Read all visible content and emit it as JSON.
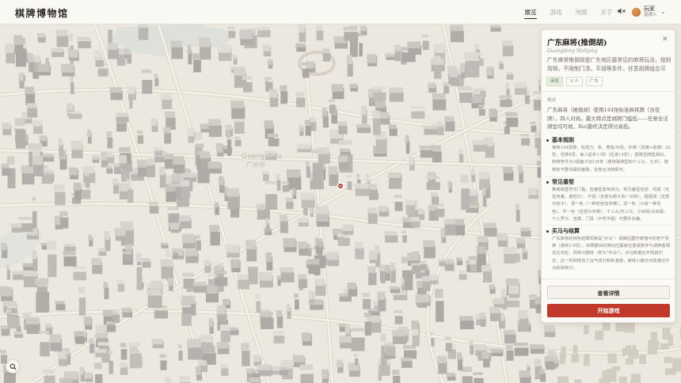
{
  "header": {
    "logo": "棋牌博物馆",
    "nav": [
      {
        "label": "展览",
        "active": true
      },
      {
        "label": "游戏",
        "active": false
      },
      {
        "label": "地图",
        "active": false
      },
      {
        "label": "关于",
        "active": false
      }
    ],
    "mute_icon": "speaker-muted-icon",
    "user": {
      "name": "玩家",
      "role": "普通人"
    }
  },
  "map": {
    "district_label_cn": "广州市",
    "district_label_en": "Guangzhou",
    "marker_color": "#c0392b"
  },
  "panel": {
    "title": "广东麻将(推倒胡)",
    "subtitle": "Guangdong Mahjong",
    "intro": "广东麻将推倒胡是广东地区最常见的麻将玩法，规则简明，不限制门清，平胡等条件，任意胡牌组合可胡。",
    "tags": [
      "麻将",
      "4 人",
      "广东"
    ],
    "overview_label": "概述",
    "overview": "广东麻将（推倒胡）使用144张标准麻将牌（含花牌），四人对局。最大特点是胡牌门槛低——任意合法牌型均可胡，But最终决定得分高低。",
    "sections": [
      {
        "title": "基本规则",
        "body": "使用144张牌，包括万、条、筒各36张，字牌（风牌+箭牌）28张，花牌8张。每人起手13张（庄家14张），摸牌至牌型胡出。和牌条件为3组面子加1对将（或特殊牌型如十三幺、七对），摸牌前不要求最低番数，任意合法牌即可。"
      },
      {
        "title": "常见番型",
        "body": "推倒胡虽然无门槛，但番型影响得分。常见番型包括：鸡胡（无任何番，最低分）、平胡（全部为顺子加一对将）、碰碰胡（全部为刻子）、混一色（一种花色加字牌）、清一色（只有一种花色）、字一色（全部为字牌）、十三幺/天三元、小四喜/大四喜、十八罗汉、自摸、门清（不吃不碰）可额外加番。"
      },
      {
        "title": "买马与结算",
        "body": "广东麻将的特色结算机制是\"买马\"：胡牌后翻开牌墙中的若干张牌（通常2-8张），如果翻出的牌对应赢家位置或数字与胡牌者相关位对应，则得分翻倍（称为\"中马\"）。买马数量在开局前约定，这一机制增加了运气成分和刺激感，使得小番也可能通过中马获得高分。"
      }
    ],
    "detail_button": "查看详情",
    "start_button": "开始游戏"
  }
}
